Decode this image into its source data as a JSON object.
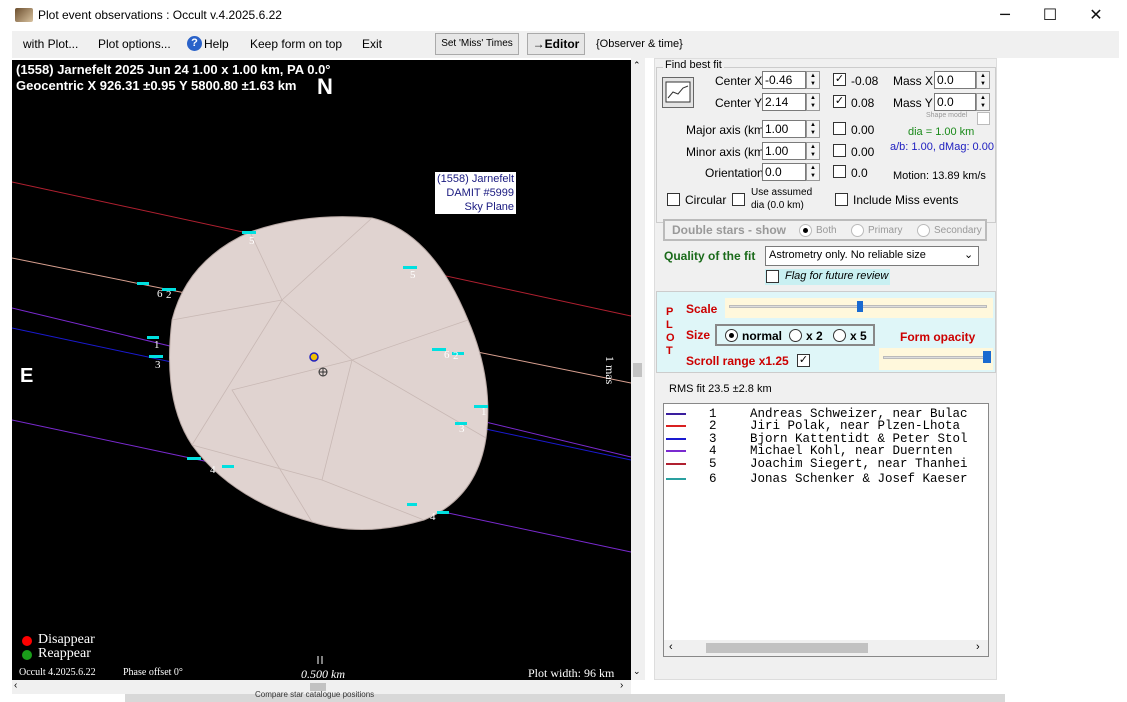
{
  "window": {
    "title": "Plot event observations : Occult v.4.2025.6.22",
    "minimize": "─",
    "maximize": "☐",
    "close": "✕"
  },
  "menu": {
    "items": [
      "with Plot...",
      "Plot options...",
      "Help",
      "Keep form on top",
      "Exit"
    ],
    "help_icon": "?",
    "set_miss": "Set 'Miss' Times",
    "editor": "→Editor",
    "observer_time": "{Observer & time}"
  },
  "plot": {
    "header_line1": "(1558) Jarnefelt  2025 Jun 24   1.00 x 1.00 km,  PA 0.0°",
    "header_line2": "Geocentric  X  926.31 ±0.95  Y 5800.80 ±1.63 km",
    "north": "N",
    "east": "E",
    "model_label": [
      "(1558) Jarnefelt",
      "DAMIT #5999",
      "Sky Plane"
    ],
    "mas_label": "1 mas",
    "legend_disappear": "Disappear",
    "legend_reappear": "Reappear",
    "version": "Occult 4.2025.6.22",
    "phase_offset": "Phase offset 0°",
    "scale_bar": "0.500 km",
    "plot_width": "Plot width: 96 km",
    "colors": {
      "disappear": "#ff0000",
      "reappear": "#1a9e1a",
      "shape": "#e0d3d0"
    }
  },
  "fit": {
    "group_title": "Find best fit",
    "center_x_label": "Center X",
    "center_x": "-0.46",
    "center_x_unc": "-0.08",
    "center_y_label": "Center Y",
    "center_y": "2.14",
    "center_y_unc": "0.08",
    "mass_x_label": "Mass X",
    "mass_x": "0.0",
    "mass_y_label": "Mass Y",
    "mass_y": "0.0",
    "shape_model": "Shape model",
    "major_label": "Major axis (km)",
    "major": "1.00",
    "major_unc": "0.00",
    "minor_label": "Minor axis (km)",
    "minor": "1.00",
    "minor_unc": "0.00",
    "orient_label": "Orientation",
    "orient": "0.0",
    "orient_unc": "0.0",
    "dia": "dia = 1.00 km",
    "ab": "a/b: 1.00, dMag: 0.00",
    "motion": "Motion: 13.89 km/s",
    "circular": "Circular",
    "use_assumed": "Use assumed",
    "assumed_dia": "dia (0.0 km)",
    "include_miss": "Include Miss events",
    "double_stars": "Double stars - show",
    "ds_both": "Both",
    "ds_primary": "Primary",
    "ds_secondary": "Secondary",
    "quality_label": "Quality of the fit",
    "quality_value": "Astrometry only. No reliable size",
    "flag_review": "Flag for future review"
  },
  "plotpanel": {
    "letters": [
      "P",
      "L",
      "O",
      "T"
    ],
    "scale": "Scale",
    "size": "Size",
    "normal": "normal",
    "x2": "x 2",
    "x5": "x 5",
    "form_opacity": "Form opacity",
    "scroll_range": "Scroll range x1.25",
    "scale_level": 0.5,
    "opacity_level": 0.98
  },
  "rms": "RMS fit 23.5 ±2.8 km",
  "observers": [
    {
      "n": "1",
      "name": "Andreas Schweizer, near Bulac",
      "color": "#3a1e9e"
    },
    {
      "n": "2",
      "name": "Jiri Polak, near Plzen-Lhota",
      "color": "#d92020"
    },
    {
      "n": "3",
      "name": "Bjorn Kattentidt & Peter Stol",
      "color": "#1a1ad0"
    },
    {
      "n": "4",
      "name": "Michael Kohl, near Duernten",
      "color": "#7a2ad0"
    },
    {
      "n": "5",
      "name": "Joachim Siegert, near Thanhei",
      "color": "#b02030"
    },
    {
      "n": "6",
      "name": "Jonas Schenker & Josef Kaeser",
      "color": "#2aa0a0"
    }
  ],
  "taskbar_text": "Compare star catalogue positions"
}
